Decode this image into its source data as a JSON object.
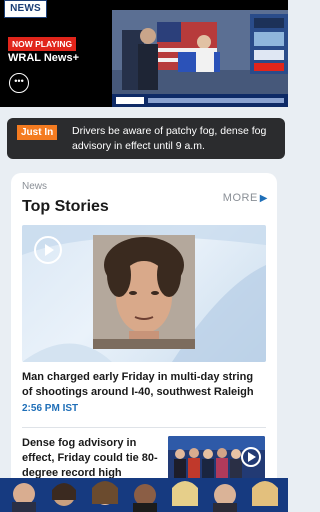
{
  "player": {
    "logo": "NEWS",
    "now_playing": "NOW PLAYING",
    "channel": "WRAL News+",
    "more_icon": "ellipsis-icon"
  },
  "alert": {
    "label": "Just In",
    "text": "Drivers be aware of patchy fog, dense fog advisory in effect until 9 a.m."
  },
  "top_stories": {
    "kicker": "News",
    "title": "Top Stories",
    "more": "MORE",
    "lead": {
      "headline": "Man charged early Friday in multi-day string of shootings around I-40, southwest Raleigh",
      "time": "2:56 PM IST"
    },
    "second": {
      "headline": "Dense fog advisory in effect, Friday could tie 80-degree record high"
    }
  },
  "colors": {
    "accent_blue": "#1f6fb8",
    "alert_orange": "#f47b20",
    "live_red": "#e1251b"
  }
}
